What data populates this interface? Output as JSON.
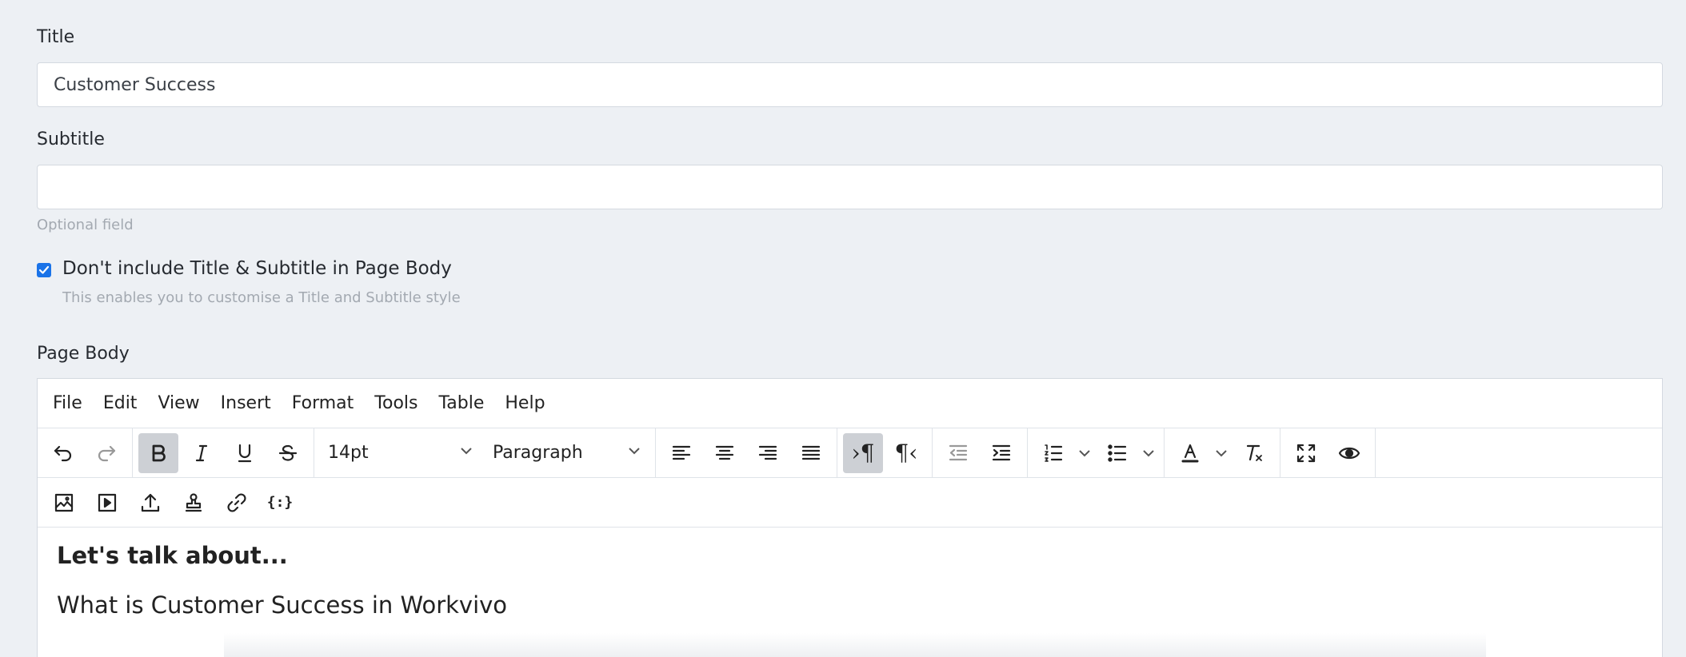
{
  "title_field": {
    "label": "Title",
    "value": "Customer Success"
  },
  "subtitle_field": {
    "label": "Subtitle",
    "value": "",
    "hint": "Optional field"
  },
  "exclude_option": {
    "checked": true,
    "label": "Don't include Title & Subtitle in Page Body",
    "hint": "This enables you to customise a Title and Subtitle style"
  },
  "body_field": {
    "label": "Page Body"
  },
  "editor": {
    "menu": [
      "File",
      "Edit",
      "View",
      "Insert",
      "Format",
      "Tools",
      "Table",
      "Help"
    ],
    "font_size": "14pt",
    "block_format": "Paragraph",
    "content": {
      "heading": "Let's talk about...",
      "paragraph": "What is Customer Success in Workvivo"
    }
  },
  "colors": {
    "background": "#edf0f4",
    "checkbox": "#1a73e8",
    "active_button": "#cdd0d5"
  }
}
